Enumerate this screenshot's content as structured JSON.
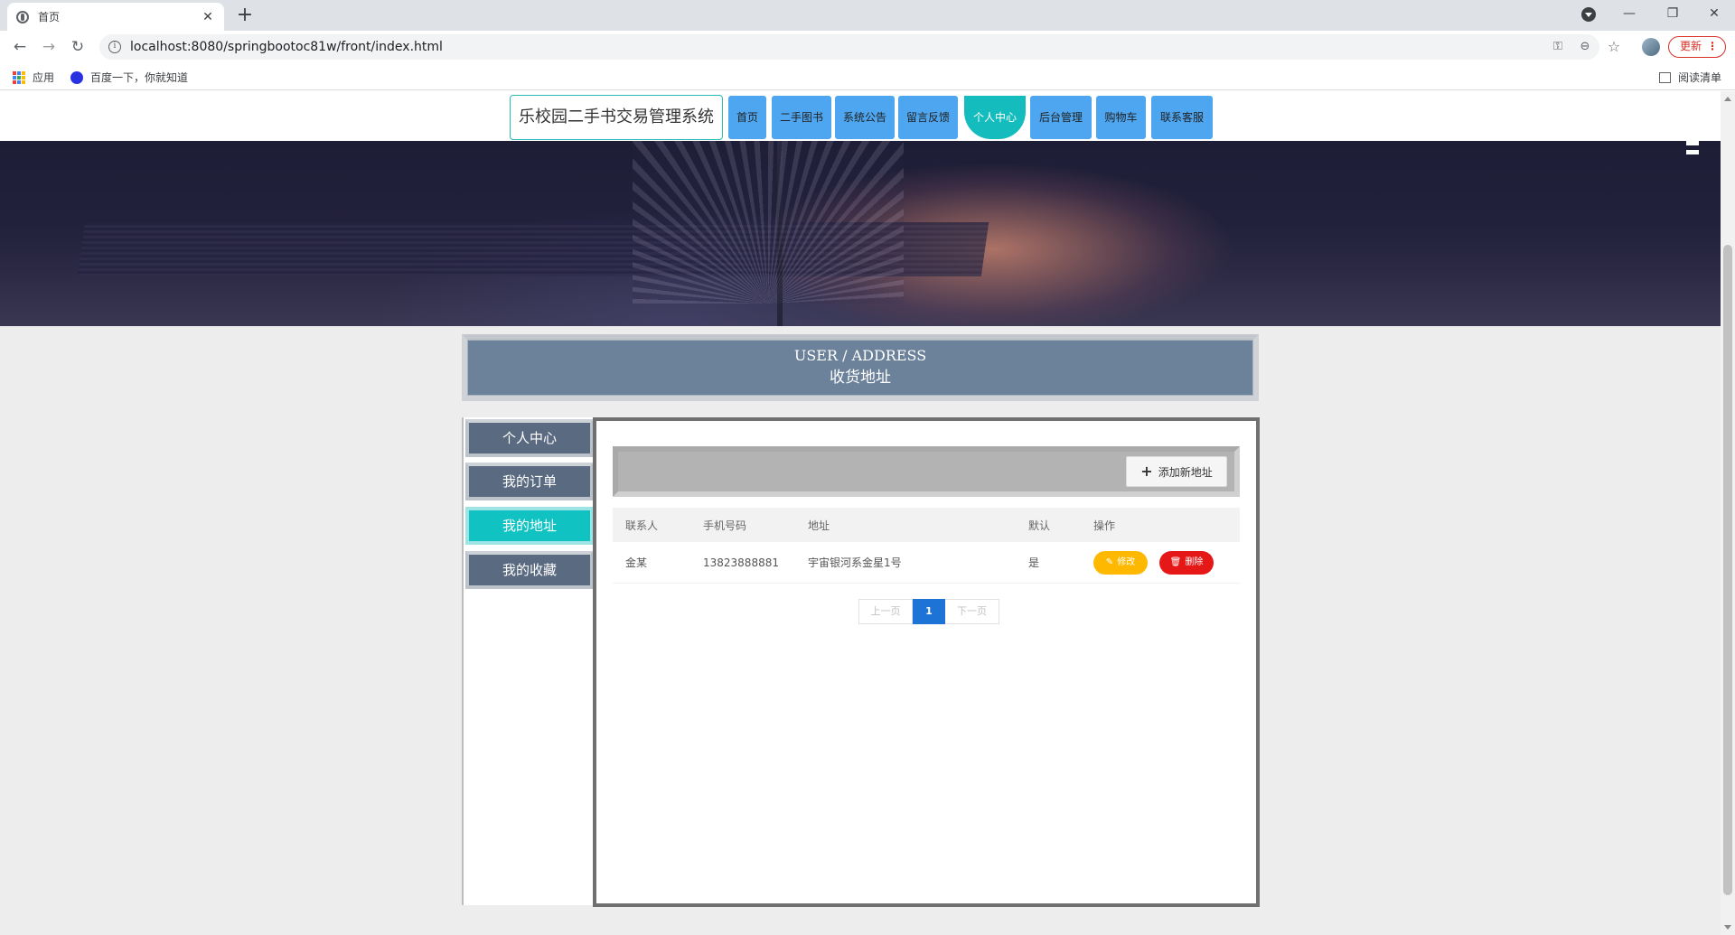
{
  "browser": {
    "tab_title": "首页",
    "tab_close": "✕",
    "new_tab": "+",
    "url": "localhost:8080/springbootoc81w/front/index.html",
    "update_label": "更新",
    "update_menu": "⋮",
    "win_minimize": "—",
    "win_restore": "❐",
    "win_close": "✕",
    "back": "←",
    "forward": "→",
    "reload": "↻",
    "key_icon": "⚿",
    "zoom_icon": "⊖",
    "star_icon": "☆",
    "bookmarks": {
      "apps_label": "应用",
      "baidu_label": "百度一下，你就知道",
      "reading_list_label": "阅读清单"
    }
  },
  "header": {
    "logo": "乐校园二手书交易管理系统",
    "menu": [
      {
        "label": "首页"
      },
      {
        "label": "二手图书"
      },
      {
        "label": "系统公告"
      },
      {
        "label": "留言反馈"
      },
      {
        "label": "个人中心"
      },
      {
        "label": "后台管理"
      },
      {
        "label": "购物车"
      },
      {
        "label": "联系客服"
      }
    ],
    "active_menu": "个人中心"
  },
  "banner": {
    "en": "USER / ADDRESS",
    "zh": "收货地址"
  },
  "sidebar": {
    "items": [
      {
        "label": "个人中心"
      },
      {
        "label": "我的订单"
      },
      {
        "label": "我的地址"
      },
      {
        "label": "我的收藏"
      }
    ],
    "active": "我的地址"
  },
  "content": {
    "add_button": "添加新地址",
    "add_icon": "+",
    "columns": [
      "联系人",
      "手机号码",
      "地址",
      "默认",
      "操作"
    ],
    "rows": [
      {
        "contact": "金某",
        "phone": "13823888881",
        "address": "宇宙银河系金星1号",
        "default": "是",
        "edit_label": "修改",
        "delete_label": "删除"
      }
    ],
    "pager": {
      "prev": "上一页",
      "current": "1",
      "next": "下一页"
    }
  },
  "colors": {
    "menu_blue": "#4ea6f1",
    "active_teal": "#15bcbd",
    "banner_slate": "#6c819a",
    "edit_yellow": "#ffb800",
    "delete_red": "#e61717",
    "pager_blue": "#1e74d6"
  }
}
